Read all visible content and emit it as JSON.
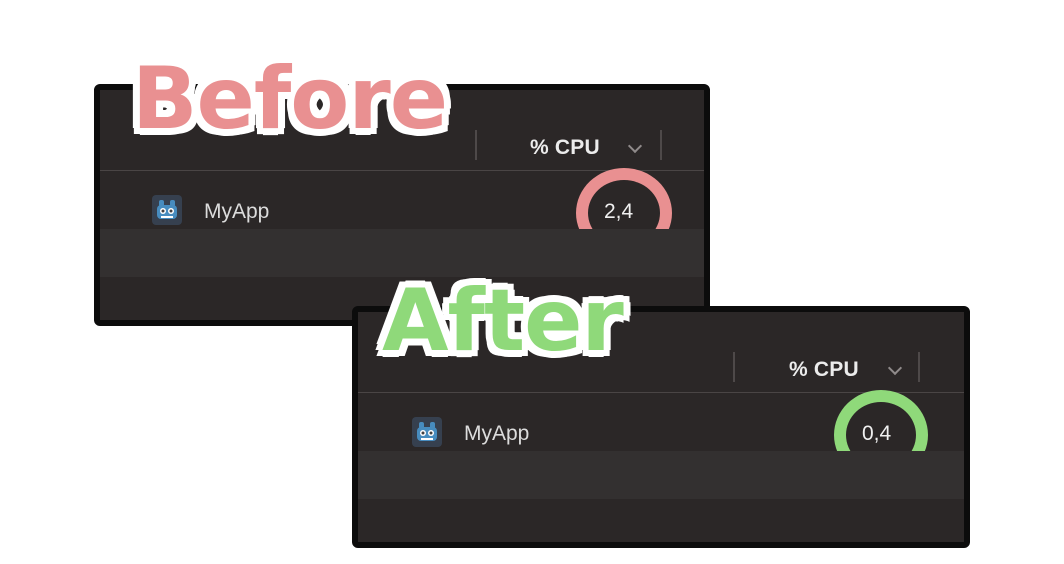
{
  "before": {
    "title": "Before",
    "title_color": "#e99091",
    "column_header": "% CPU",
    "row": {
      "app_icon": "godot-icon",
      "app_name": "MyApp",
      "cpu": "2,4"
    },
    "highlight_color": "#e99091"
  },
  "after": {
    "title": "After",
    "title_color": "#8fd97a",
    "column_header": "% CPU",
    "row": {
      "app_icon": "godot-icon",
      "app_name": "MyApp",
      "cpu": "0,4"
    },
    "highlight_color": "#8fd97a"
  },
  "colors": {
    "panel_background": "#2b2727",
    "panel_border": "#0c0c0c",
    "text": "#dcdcdc"
  }
}
